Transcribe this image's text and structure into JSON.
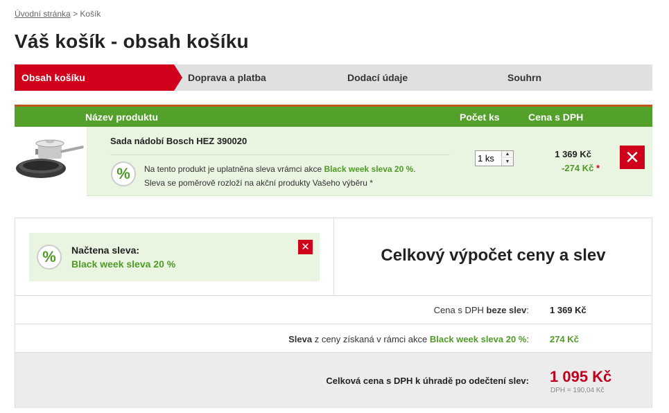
{
  "breadcrumb": {
    "home": "Úvodní stránka",
    "separator": ">",
    "current": "Košík"
  },
  "title": "Váš košík - obsah košíku",
  "steps": [
    {
      "label": "Obsah košíku",
      "active": true
    },
    {
      "label": "Doprava a platba",
      "active": false
    },
    {
      "label": "Dodací údaje",
      "active": false
    },
    {
      "label": "Souhrn",
      "active": false
    }
  ],
  "colors": {
    "accent_red": "#d0021b",
    "green": "#53a02a",
    "green_text": "#4f9a26",
    "light_green": "#e9f4e1"
  },
  "table": {
    "headers": {
      "product": "Název produktu",
      "qty": "Počet ks",
      "price": "Cena s DPH"
    },
    "item": {
      "name": "Sada nádobí Bosch HEZ 390020",
      "image_icon": "cookware-set-image",
      "promo_prefix": "Na tento produkt je uplatněna sleva vrámci akce",
      "promo_name": "Black week sleva 20 %",
      "promo_suffix": ".",
      "promo_line2": "Sleva se poměrově rozloží na akční produkty Vašeho výběru *",
      "qty": "1 ks",
      "price": "1 369 Kč",
      "discount": "-274 Kč",
      "discount_star": "*",
      "percent_icon": "%",
      "delete_icon": "✕"
    }
  },
  "summary": {
    "loaded_label": "Načtena sleva:",
    "loaded_name": "Black week sleva 20 %",
    "remove_icon": "✕",
    "percent_icon": "%",
    "title": "Celkový výpočet ceny a slev",
    "row1": {
      "label_prefix": "Cena s DPH ",
      "label_bold": "beze slev",
      "label_suffix": ":",
      "value": "1 369 Kč"
    },
    "row2": {
      "label_bold": "Sleva",
      "label_mid": " z ceny získaná v rámci akce ",
      "label_green": "Black week sleva 20 %",
      "label_suffix": ":",
      "value": "274 Kč"
    },
    "row3": {
      "label": "Celková cena s DPH k úhradě po odečtení slev:",
      "value": "1 095 Kč",
      "vat": "DPH = 190,04 Kč"
    }
  }
}
